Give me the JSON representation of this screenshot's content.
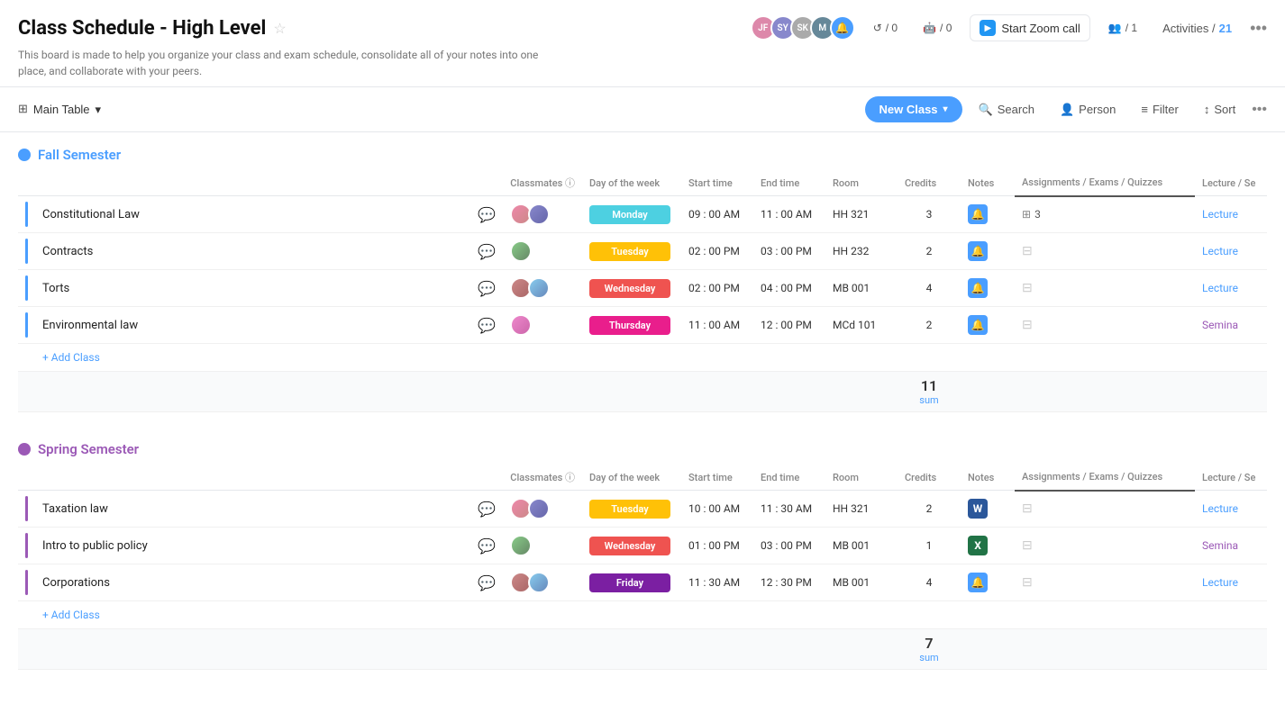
{
  "header": {
    "title": "Class Schedule - High Level",
    "subtitle": "This board is made to help you organize your class and exam schedule, consolidate all of your notes into one place, and collaborate with your peers.",
    "zoom_btn": "Start Zoom call",
    "invites_count": "/ 0",
    "robots_count": "/ 0",
    "members_count": "/ 1",
    "activities_label": "Activities /",
    "activities_count": "21"
  },
  "toolbar": {
    "main_table_label": "Main Table",
    "new_class_label": "New Class",
    "search_label": "Search",
    "person_label": "Person",
    "filter_label": "Filter",
    "sort_label": "Sort"
  },
  "fall_semester": {
    "title": "Fall Semester",
    "columns": {
      "classmates": "Classmates",
      "day": "Day of the week",
      "start_time": "Start time",
      "end_time": "End time",
      "room": "Room",
      "credits": "Credits",
      "notes": "Notes",
      "assignments": "Assignments / Exams / Quizzes",
      "lecture": "Lecture / Se"
    },
    "rows": [
      {
        "name": "Constitutional Law",
        "day": "Monday",
        "day_class": "day-monday",
        "start": "09 : 00 AM",
        "end": "11 : 00 AM",
        "room": "HH 321",
        "credits": "3",
        "notes_type": "blue",
        "assign_count": "3",
        "lecture_type": "lecture",
        "lecture_label": "Lecture"
      },
      {
        "name": "Contracts",
        "day": "Tuesday",
        "day_class": "day-tuesday",
        "start": "02 : 00 PM",
        "end": "03 : 00 PM",
        "room": "HH 232",
        "credits": "2",
        "notes_type": "blue",
        "assign_count": "",
        "lecture_type": "lecture",
        "lecture_label": "Lecture"
      },
      {
        "name": "Torts",
        "day": "Wednesday",
        "day_class": "day-wednesday",
        "start": "02 : 00 PM",
        "end": "04 : 00 PM",
        "room": "MB 001",
        "credits": "4",
        "notes_type": "blue",
        "assign_count": "",
        "lecture_type": "lecture",
        "lecture_label": "Lecture"
      },
      {
        "name": "Environmental law",
        "day": "Thursday",
        "day_class": "day-thursday",
        "start": "11 : 00 AM",
        "end": "12 : 00 PM",
        "room": "MCd 101",
        "credits": "2",
        "notes_type": "blue",
        "assign_count": "",
        "lecture_type": "seminar",
        "lecture_label": "Semina"
      }
    ],
    "add_class": "+ Add Class",
    "sum_value": "11",
    "sum_label": "sum"
  },
  "spring_semester": {
    "title": "Spring Semester",
    "columns": {
      "classmates": "Classmates",
      "day": "Day of the week",
      "start_time": "Start time",
      "end_time": "End time",
      "room": "Room",
      "credits": "Credits",
      "notes": "Notes",
      "assignments": "Assignments / Exams / Quizzes",
      "lecture": "Lecture / Se"
    },
    "rows": [
      {
        "name": "Taxation law",
        "day": "Tuesday",
        "day_class": "day-tuesday",
        "start": "10 : 00 AM",
        "end": "11 : 30 AM",
        "room": "HH 321",
        "credits": "2",
        "notes_type": "word",
        "assign_count": "",
        "lecture_type": "lecture",
        "lecture_label": "Lecture"
      },
      {
        "name": "Intro to public policy",
        "day": "Wednesday",
        "day_class": "day-wednesday",
        "start": "01 : 00 PM",
        "end": "03 : 00 PM",
        "room": "MB 001",
        "credits": "1",
        "notes_type": "excel",
        "assign_count": "",
        "lecture_type": "seminar",
        "lecture_label": "Semina"
      },
      {
        "name": "Corporations",
        "day": "Friday",
        "day_class": "day-friday",
        "start": "11 : 30 AM",
        "end": "12 : 30 PM",
        "room": "MB 001",
        "credits": "4",
        "notes_type": "blue",
        "assign_count": "",
        "lecture_type": "lecture",
        "lecture_label": "Lecture"
      }
    ],
    "add_class": "+ Add Class",
    "sum_value": "7",
    "sum_label": "sum"
  }
}
